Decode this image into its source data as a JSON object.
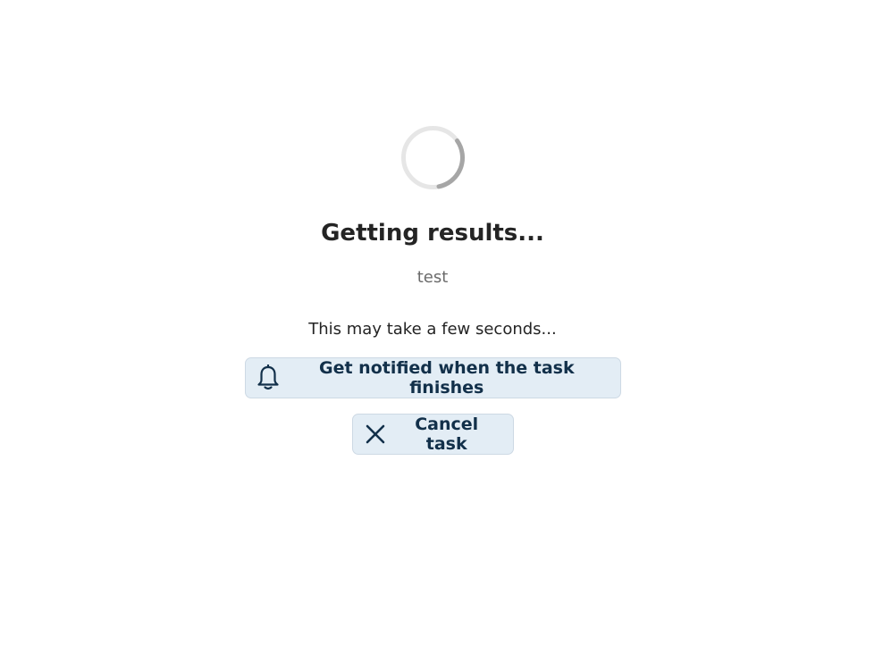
{
  "loading": {
    "spinner_icon": "loading-spinner-icon",
    "title": "Getting results...",
    "task_name": "test",
    "hint": "This may take a few seconds..."
  },
  "actions": {
    "notify": {
      "label": "Get notified when the task finishes",
      "icon": "bell-icon"
    },
    "cancel": {
      "label": "Cancel task",
      "icon": "close-icon"
    }
  },
  "colors": {
    "button_bg": "#e3edf5",
    "button_text": "#12304a",
    "title_text": "#242424",
    "muted_text": "#6b6b6b",
    "spinner_track": "#e6e6e6",
    "spinner_arc": "#a6a6a6"
  }
}
